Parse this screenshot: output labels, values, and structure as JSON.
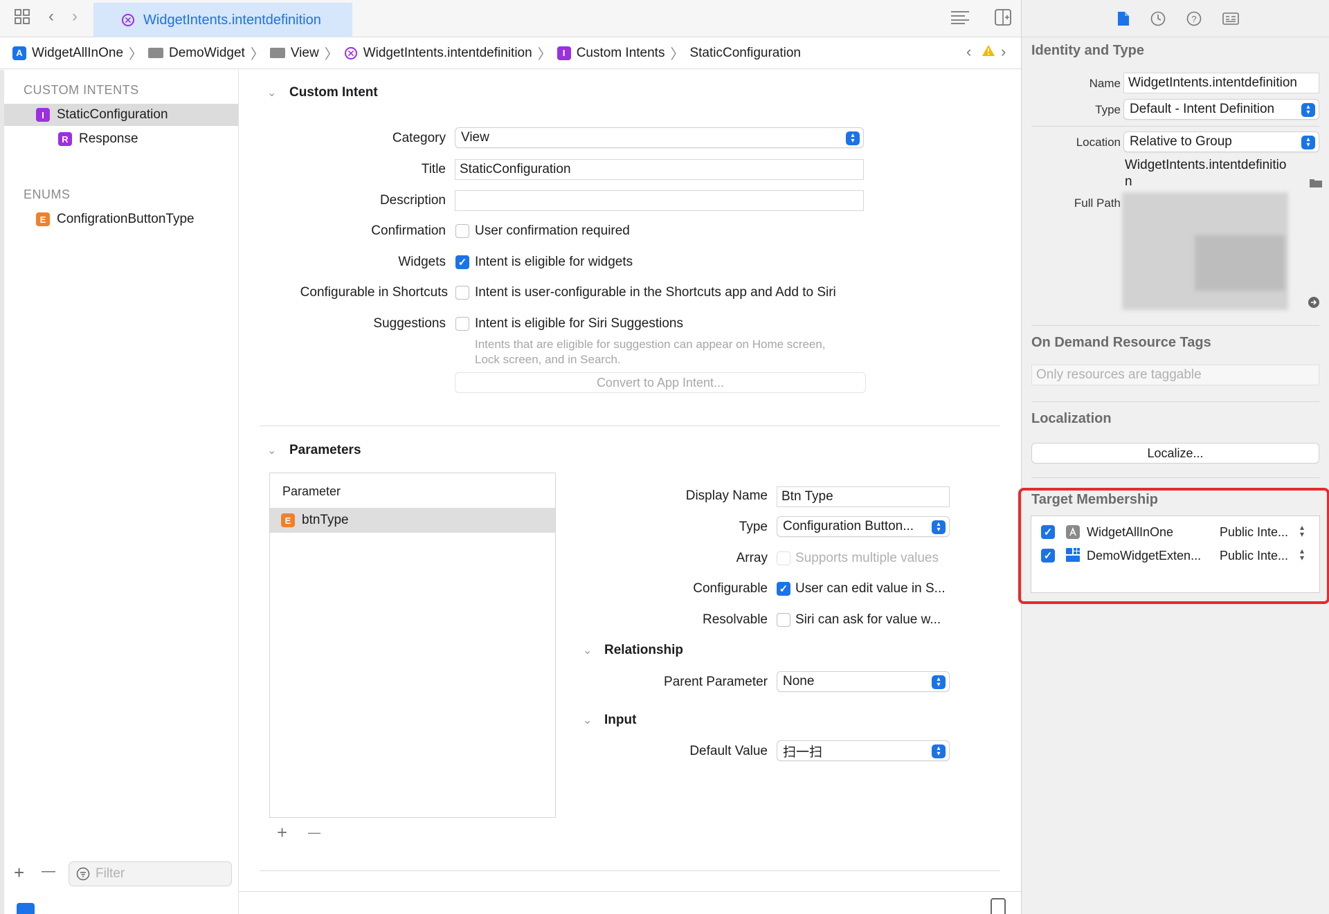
{
  "tab": {
    "active_label": "WidgetIntents.intentdefinition"
  },
  "breadcrumb": {
    "items": [
      "WidgetAllInOne",
      "DemoWidget",
      "View",
      "WidgetIntents.intentdefinition",
      "Custom Intents",
      "StaticConfiguration"
    ],
    "badge_letters": {
      "custom_intents": "I"
    }
  },
  "navigator": {
    "section_custom_intents": "CUSTOM INTENTS",
    "intent_badge": "I",
    "intent": "StaticConfiguration",
    "response_badge": "R",
    "response": "Response",
    "section_enums": "ENUMS",
    "enum_badge": "E",
    "enum": "ConfigrationButtonType",
    "add": "+",
    "remove": "—",
    "filter_placeholder": "Filter"
  },
  "custom_intent": {
    "section_title": "Custom Intent",
    "category_label": "Category",
    "category_value": "View",
    "title_label": "Title",
    "title_value": "StaticConfiguration",
    "description_label": "Description",
    "description_value": "",
    "confirmation_label": "Confirmation",
    "confirmation_text": "User confirmation required",
    "confirmation_checked": false,
    "widgets_label": "Widgets",
    "widgets_text": "Intent is eligible for widgets",
    "widgets_checked": true,
    "shortcuts_label": "Configurable in Shortcuts",
    "shortcuts_text": "Intent is user-configurable in the Shortcuts app and Add to Siri",
    "shortcuts_checked": false,
    "suggestions_label": "Suggestions",
    "suggestions_text": "Intent is eligible for Siri Suggestions",
    "suggestions_checked": false,
    "suggestions_hint_1": "Intents that are eligible for suggestion can appear on Home screen,",
    "suggestions_hint_2": "Lock screen, and in Search.",
    "convert_button": "Convert to App Intent..."
  },
  "parameters": {
    "section_title": "Parameters",
    "table_header": "Parameter",
    "row_badge": "E",
    "row_name": "btnType",
    "add": "+",
    "remove": "—",
    "display_name_label": "Display Name",
    "display_name_value": "Btn Type",
    "type_label": "Type",
    "type_value": "Configuration Button...",
    "array_label": "Array",
    "array_text": "Supports multiple values",
    "configurable_label": "Configurable",
    "configurable_text": "User can edit value in S...",
    "configurable_checked": true,
    "resolvable_label": "Resolvable",
    "resolvable_text": "Siri can ask for value w...",
    "resolvable_checked": false,
    "relationship_title": "Relationship",
    "parent_label": "Parent Parameter",
    "parent_value": "None",
    "input_title": "Input",
    "default_label": "Default Value",
    "default_value": "扫一扫"
  },
  "inspector": {
    "identity_title": "Identity and Type",
    "name_label": "Name",
    "name_value": "WidgetIntents.intentdefinition",
    "type_label": "Type",
    "type_value": "Default - Intent Definition",
    "location_label": "Location",
    "location_value": "Relative to Group",
    "location_file_1": "WidgetIntents.intentdefinitio",
    "location_file_2": "n",
    "full_path_label": "Full Path",
    "odr_title": "On Demand Resource Tags",
    "odr_placeholder": "Only resources are taggable",
    "localization_title": "Localization",
    "localize_button": "Localize...",
    "target_title": "Target Membership",
    "targets": [
      {
        "name": "WidgetAllInOne",
        "access": "Public Inte...",
        "checked": true
      },
      {
        "name": "DemoWidgetExten...",
        "access": "Public Inte...",
        "checked": true
      }
    ]
  },
  "colors": {
    "accent": "#1a73e8",
    "intent_badge": "#9b30e0",
    "enum_badge": "#f0802a",
    "highlight": "#e52c2c"
  }
}
